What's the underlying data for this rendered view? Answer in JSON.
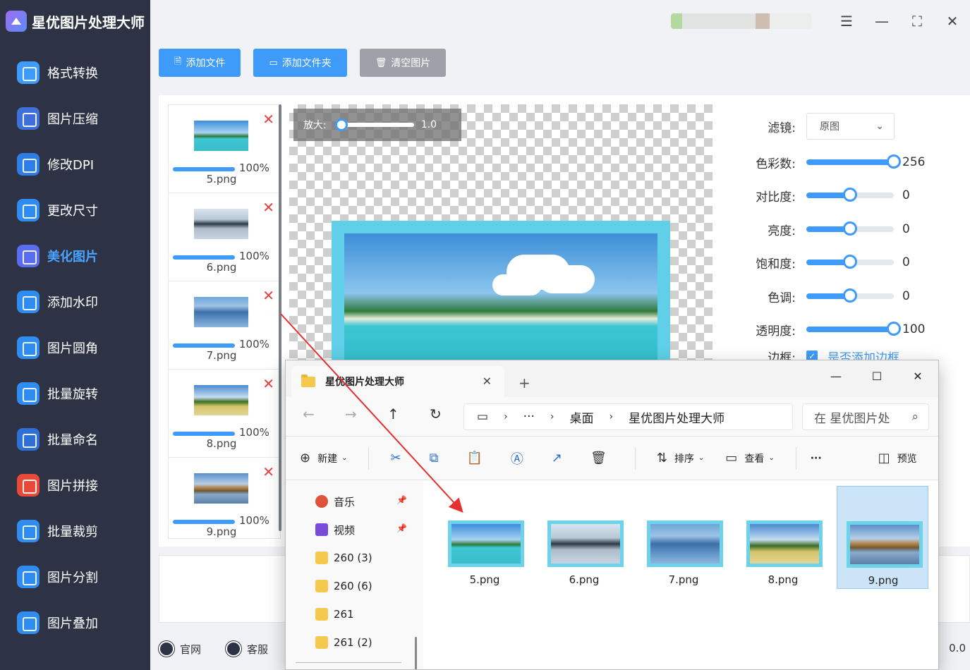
{
  "app": {
    "title": "星优图片处理大师"
  },
  "sidebar": {
    "items": [
      {
        "label": "格式转换",
        "icon": "format-convert-icon",
        "color": "#3f9bfa"
      },
      {
        "label": "图片压缩",
        "icon": "compress-icon",
        "color": "#3f6fd8"
      },
      {
        "label": "修改DPI",
        "icon": "dpi-icon",
        "color": "#2f7de8"
      },
      {
        "label": "更改尺寸",
        "icon": "resize-icon",
        "color": "#2f8cf0"
      },
      {
        "label": "美化图片",
        "icon": "beautify-icon",
        "color": "#5a6cf0"
      },
      {
        "label": "添加水印",
        "icon": "watermark-icon",
        "color": "#2f8cf0"
      },
      {
        "label": "图片圆角",
        "icon": "rounded-corner-icon",
        "color": "#2f8cf0"
      },
      {
        "label": "批量旋转",
        "icon": "rotate-icon",
        "color": "#2f8cf0"
      },
      {
        "label": "批量命名",
        "icon": "rename-icon",
        "color": "#2f6fd8"
      },
      {
        "label": "图片拼接",
        "icon": "puzzle-icon",
        "color": "#e84a3a"
      },
      {
        "label": "批量裁剪",
        "icon": "crop-icon",
        "color": "#2f8cf0"
      },
      {
        "label": "图片分割",
        "icon": "split-icon",
        "color": "#2f8cf0"
      },
      {
        "label": "图片叠加",
        "icon": "layers-icon",
        "color": "#2f8cf0"
      }
    ],
    "active_index": 4
  },
  "toolbar": {
    "add_file": "添加文件",
    "add_folder": "添加文件夹",
    "clear": "清空图片"
  },
  "files": [
    {
      "name": "5.png",
      "progress": "100%",
      "thumb": "beach"
    },
    {
      "name": "6.png",
      "progress": "100%",
      "thumb": "lake"
    },
    {
      "name": "7.png",
      "progress": "100%",
      "thumb": "mount"
    },
    {
      "name": "8.png",
      "progress": "100%",
      "thumb": "tree"
    },
    {
      "name": "9.png",
      "progress": "100%",
      "thumb": "autumn"
    }
  ],
  "zoom": {
    "label": "放大:",
    "value": "1.0"
  },
  "settings": {
    "filter_label": "滤镜:",
    "filter_value": "原图",
    "sliders": [
      {
        "label": "色彩数:",
        "value": "256",
        "level": 1.0
      },
      {
        "label": "对比度:",
        "value": "0",
        "level": 0.5
      },
      {
        "label": "亮度:",
        "value": "0",
        "level": 0.5
      },
      {
        "label": "饱和度:",
        "value": "0",
        "level": 0.5
      },
      {
        "label": "色调:",
        "value": "0",
        "level": 0.5
      },
      {
        "label": "透明度:",
        "value": "100",
        "level": 1.0
      }
    ],
    "border_label": "边框:",
    "border_checkbox": "是否添加边框"
  },
  "footer": {
    "website": "官网",
    "service": "客服",
    "version": "0.0"
  },
  "explorer": {
    "tab_title": "星优图片处理大师",
    "path": [
      "桌面",
      "星优图片处理大师"
    ],
    "path_more": "···",
    "search_placeholder": "在 星优图片处",
    "commands": {
      "new": "新建",
      "sort": "排序",
      "view": "查看",
      "more": "···",
      "preview": "预览"
    },
    "sidebar": [
      {
        "label": "音乐",
        "pinned": true,
        "type": "music"
      },
      {
        "label": "视频",
        "pinned": true,
        "type": "video"
      },
      {
        "label": "260 (3)",
        "pinned": false,
        "type": "folder"
      },
      {
        "label": "260 (6)",
        "pinned": false,
        "type": "folder"
      },
      {
        "label": "261",
        "pinned": false,
        "type": "folder"
      },
      {
        "label": "261 (2)",
        "pinned": false,
        "type": "folder"
      }
    ],
    "files": [
      {
        "name": "5.png",
        "thumb": "beach",
        "selected": false
      },
      {
        "name": "6.png",
        "thumb": "lake",
        "selected": false
      },
      {
        "name": "7.png",
        "thumb": "mount",
        "selected": false
      },
      {
        "name": "8.png",
        "thumb": "tree",
        "selected": false
      },
      {
        "name": "9.png",
        "thumb": "autumn",
        "selected": true
      }
    ]
  }
}
